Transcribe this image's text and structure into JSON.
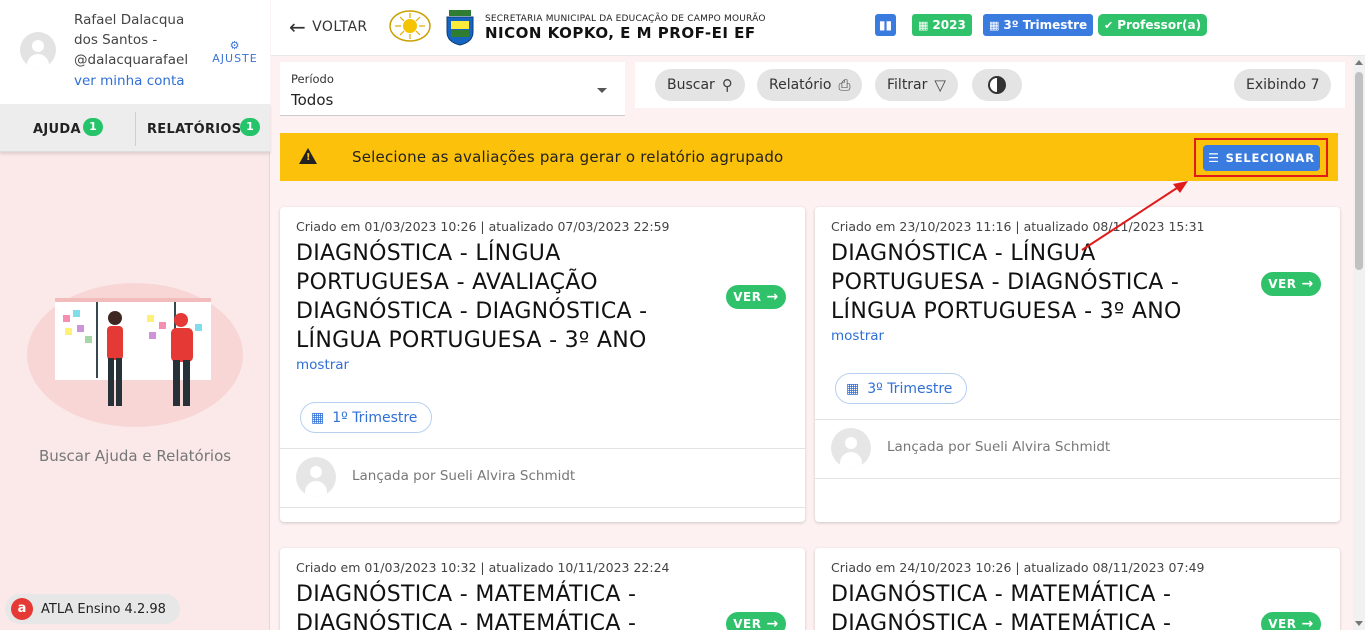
{
  "user": {
    "name": "Rafael Dalacqua dos Santos - @dalacquarafael",
    "account_link": "ver minha conta",
    "settings_label": "AJUSTE"
  },
  "sidebar": {
    "tabs": [
      {
        "label": "AJUDA",
        "badge": "1"
      },
      {
        "label": "RELATÓRIOS",
        "badge": "1"
      }
    ],
    "help_text": "Buscar Ajuda e Relatórios",
    "version": "ATLA Ensino 4.2.98"
  },
  "header": {
    "back_label": "VOLTAR",
    "school_subtitle": "SECRETARIA MUNICIPAL DA EDUCAÇÃO DE CAMPO MOURÃO",
    "school_name": "NICON KOPKO, E M PROF-EI EF",
    "chips": {
      "year": "2023",
      "trimester": "3º Trimestre",
      "role": "Professor(a)"
    }
  },
  "filters": {
    "period_label": "Período",
    "period_value": "Todos",
    "search_label": "Buscar",
    "report_label": "Relatório",
    "filter_label": "Filtrar",
    "showing_label": "Exibindo 7"
  },
  "banner": {
    "message": "Selecione as avaliações para gerar o relatório agrupado",
    "select_button": "SELECIONAR"
  },
  "cards": [
    {
      "meta": "Criado em 01/03/2023 10:26 | atualizado 07/03/2023 22:59",
      "title": "DIAGNÓSTICA - LÍNGUA PORTUGUESA - AVALIAÇÃO DIAGNÓSTICA - DIAGNÓSTICA - LÍNGUA PORTUGUESA - 3º ANO",
      "show_label": "mostrar",
      "view_label": "VER",
      "trimester": "1º Trimestre",
      "launched_by": "Lançada por Sueli Alvira Schmidt"
    },
    {
      "meta": "Criado em 23/10/2023 11:16 | atualizado 08/11/2023 15:31",
      "title": "DIAGNÓSTICA - LÍNGUA PORTUGUESA - DIAGNÓSTICA - LÍNGUA PORTUGUESA - 3º ANO",
      "show_label": "mostrar",
      "view_label": "VER",
      "trimester": "3º Trimestre",
      "launched_by": "Lançada por Sueli Alvira Schmidt"
    },
    {
      "meta": "Criado em 01/03/2023 10:32 | atualizado 10/11/2023 22:24",
      "title": "DIAGNÓSTICA - MATEMÁTICA - DIAGNÓSTICA - MATEMÁTICA -",
      "view_label": "VER"
    },
    {
      "meta": "Criado em 24/10/2023 10:26 | atualizado 08/11/2023 07:49",
      "title": "DIAGNÓSTICA - MATEMÁTICA - DIAGNÓSTICA - MATEMÁTICA -",
      "view_label": "VER"
    }
  ],
  "colors": {
    "green": "#2fc26a",
    "blue": "#3a7be0",
    "banner": "#fcc10a",
    "highlight": "#e01b1b"
  }
}
